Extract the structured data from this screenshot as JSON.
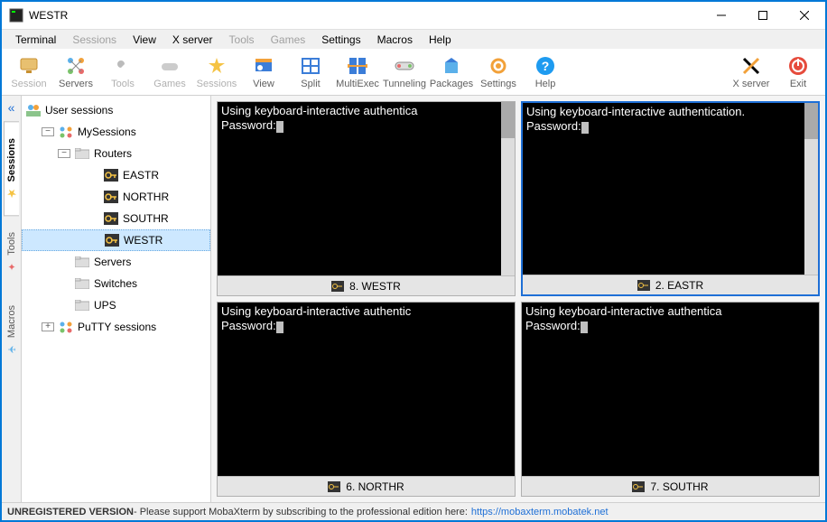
{
  "title": "WESTR",
  "menus": {
    "terminal": "Terminal",
    "sessions": "Sessions",
    "view": "View",
    "xserver": "X server",
    "tools": "Tools",
    "games": "Games",
    "settings": "Settings",
    "macros": "Macros",
    "help": "Help"
  },
  "toolbar": {
    "session": "Session",
    "servers": "Servers",
    "tools": "Tools",
    "games": "Games",
    "sessions": "Sessions",
    "view": "View",
    "split": "Split",
    "multiexec": "MultiExec",
    "tunneling": "Tunneling",
    "packages": "Packages",
    "settings": "Settings",
    "help": "Help",
    "xserver": "X server",
    "exit": "Exit"
  },
  "side_tabs": {
    "sessions": "Sessions",
    "tools": "Tools",
    "macros": "Macros"
  },
  "tree": {
    "user_sessions": "User sessions",
    "mysessions": "MySessions",
    "routers": "Routers",
    "eastr": "EASTR",
    "northr": "NORTHR",
    "southr": "SOUTHR",
    "westr": "WESTR",
    "servers": "Servers",
    "switches": "Switches",
    "ups": "UPS",
    "putty": "PuTTY sessions"
  },
  "terminals": [
    {
      "label": "8. WESTR",
      "text": "Using keyboard-interactive authentica\nPassword:"
    },
    {
      "label": "2. EASTR",
      "text": "Using keyboard-interactive authentication.\nPassword:"
    },
    {
      "label": "6. NORTHR",
      "text": "Using keyboard-interactive authentic\nPassword:"
    },
    {
      "label": "7. SOUTHR",
      "text": "Using keyboard-interactive authentica\nPassword:"
    }
  ],
  "status": {
    "unreg": "UNREGISTERED VERSION",
    "msg": " -  Please support MobaXterm by subscribing to the professional edition here:",
    "link": "https://mobaxterm.mobatek.net"
  }
}
